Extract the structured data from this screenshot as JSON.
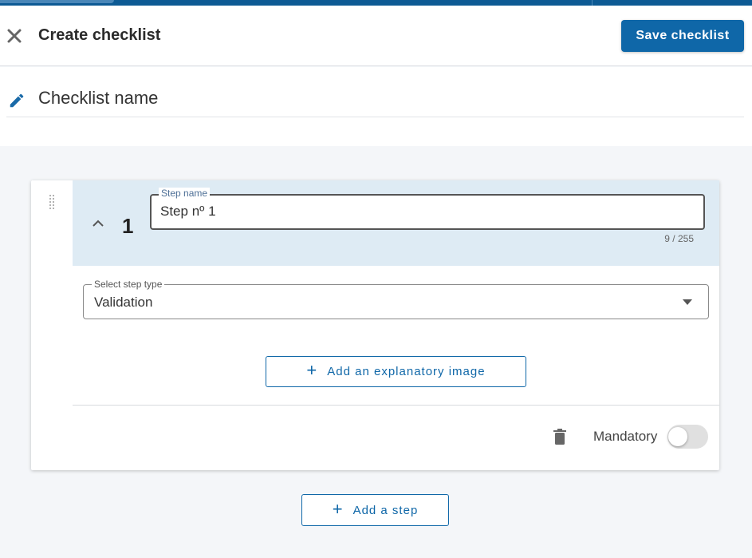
{
  "header": {
    "title": "Create checklist",
    "save_label": "Save checklist",
    "close_icon": "close-icon"
  },
  "checklist": {
    "name_placeholder": "Checklist name",
    "name_value": "",
    "edit_icon": "pencil-icon"
  },
  "step": {
    "number": "1",
    "name_label": "Step name",
    "name_value": "Step nº 1",
    "char_count": "9 / 255",
    "type_label": "Select step type",
    "type_value": "Validation",
    "add_image_label": "Add an explanatory image",
    "mandatory_label": "Mandatory",
    "mandatory_on": false,
    "expanded": true
  },
  "add_step_label": "Add a step",
  "colors": {
    "primary": "#0f67a8",
    "topbar": "#0d5a94",
    "step_header_bg": "#deebf4",
    "page_bg": "#f4f6f9"
  }
}
